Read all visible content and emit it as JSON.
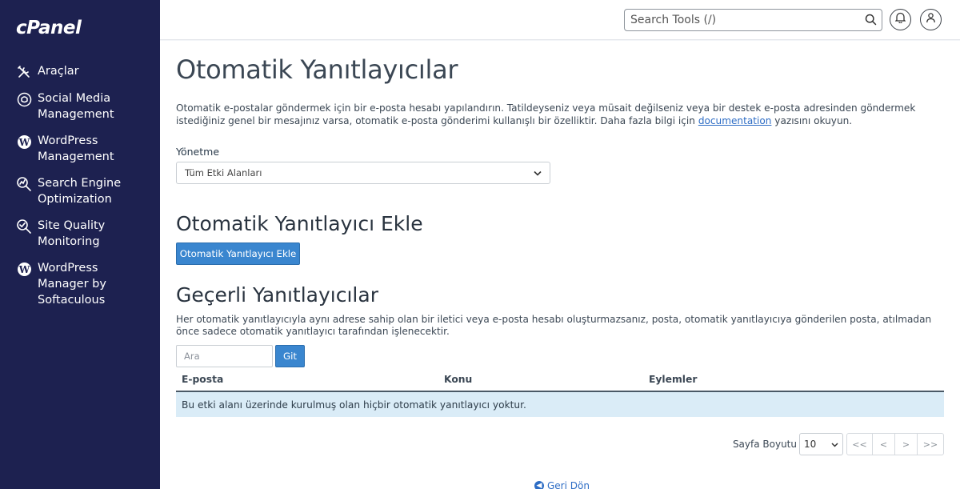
{
  "brand": {
    "logo_text": "cPanel"
  },
  "sidebar": {
    "items": [
      {
        "icon": "tools-icon",
        "label": "Araçlar"
      },
      {
        "icon": "social-media-icon",
        "label": "Social Media Management"
      },
      {
        "icon": "wordpress-icon",
        "label": "WordPress Management"
      },
      {
        "icon": "seo-icon",
        "label": "Search Engine Optimization"
      },
      {
        "icon": "site-quality-icon",
        "label": "Site Quality Monitoring"
      },
      {
        "icon": "wordpress-icon",
        "label": "WordPress Manager by Softaculous"
      }
    ]
  },
  "topbar": {
    "search_placeholder": "Search Tools (/)",
    "icons": [
      "search-icon",
      "bell-icon",
      "user-icon"
    ]
  },
  "page": {
    "title": "Otomatik Yanıtlayıcılar",
    "intro_text": "Otomatik e-postalar göndermek için bir e-posta hesabı yapılandırın. Tatildeyseniz veya müsait değilseniz veya bir destek e-posta adresinden göndermek istediğiniz genel bir mesajınız varsa, otomatik e-posta gönderimi kullanışlı bir özelliktir. Daha fazla bilgi için",
    "intro_link": "documentation",
    "intro_suffix": "yazısını okuyun.",
    "manage_label": "Yönetme",
    "domain_select_value": "Tüm Etki Alanları"
  },
  "add_section": {
    "heading": "Otomatik Yanıtlayıcı Ekle",
    "button_label": "Otomatik Yanıtlayıcı Ekle"
  },
  "current_section": {
    "heading": "Geçerli Yanıtlayıcılar",
    "description": "Her otomatik yanıtlayıcıyla aynı adrese sahip olan bir iletici veya e-posta hesabı oluşturmazsanız, posta, otomatik yanıtlayıcıya gönderilen posta, atılmadan önce sadece otomatik yanıtlayıcı tarafından işlenecektir.",
    "search_placeholder": "Ara",
    "go_label": "Git",
    "columns": [
      "E-posta",
      "Konu",
      "Eylemler"
    ],
    "empty_message": "Bu etki alanı üzerinde kurulmuş olan hiçbir otomatik yanıtlayıcı yoktur."
  },
  "pagination": {
    "page_size_label": "Sayfa Boyutu",
    "page_size_value": "10",
    "first": "<<",
    "prev": "<",
    "next": ">",
    "last": ">>"
  },
  "footer": {
    "back_label": "Geri Dön"
  }
}
